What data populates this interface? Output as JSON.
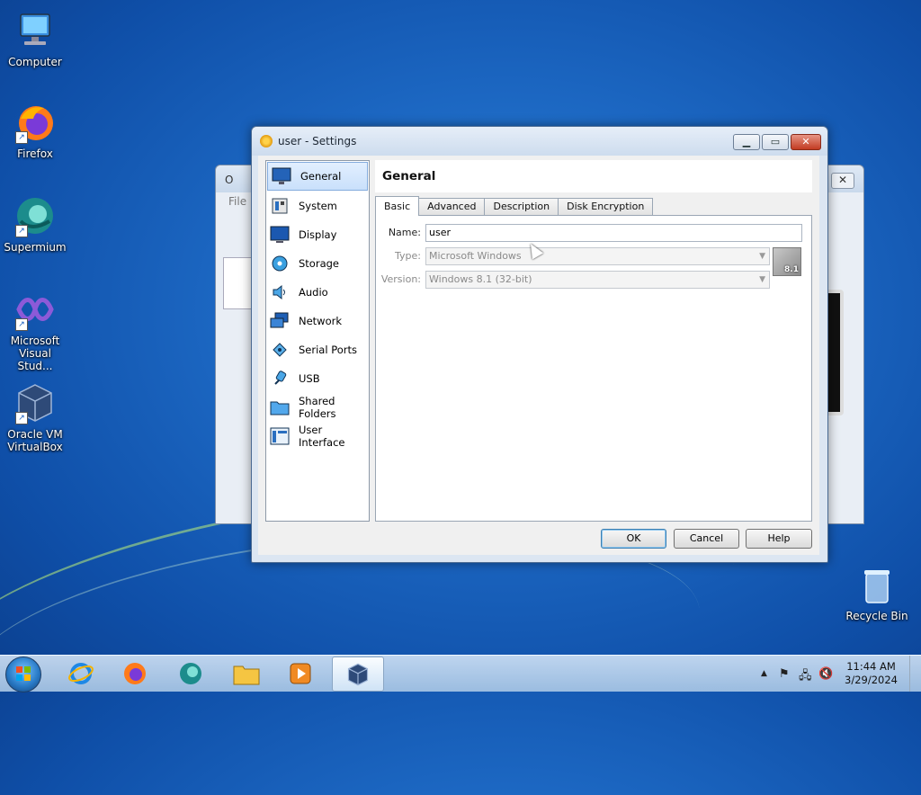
{
  "desktop": {
    "icons": [
      {
        "label": "Computer"
      },
      {
        "label": "Firefox"
      },
      {
        "label": "Supermium"
      },
      {
        "label": "Microsoft Visual Stud..."
      },
      {
        "label": "Oracle VM VirtualBox"
      },
      {
        "label": "Recycle Bin"
      }
    ]
  },
  "background_window": {
    "title_fragment": "O",
    "menu_file": "File"
  },
  "dialog": {
    "title": "user - Settings",
    "min_symbol": "▁",
    "max_symbol": "▭",
    "close_symbol": "✕"
  },
  "nav": {
    "items": [
      {
        "label": "General",
        "icon": "monitor-icon",
        "selected": true
      },
      {
        "label": "System",
        "icon": "chip-icon"
      },
      {
        "label": "Display",
        "icon": "display-icon"
      },
      {
        "label": "Storage",
        "icon": "disk-icon"
      },
      {
        "label": "Audio",
        "icon": "speaker-icon"
      },
      {
        "label": "Network",
        "icon": "network-icon"
      },
      {
        "label": "Serial Ports",
        "icon": "serial-port-icon"
      },
      {
        "label": "USB",
        "icon": "usb-icon"
      },
      {
        "label": "Shared Folders",
        "icon": "folder-icon"
      },
      {
        "label": "User Interface",
        "icon": "ui-icon"
      }
    ]
  },
  "section": {
    "title": "General",
    "tabs": [
      {
        "label": "Basic",
        "active": true
      },
      {
        "label": "Advanced"
      },
      {
        "label": "Description"
      },
      {
        "label": "Disk Encryption"
      }
    ]
  },
  "form": {
    "name_label": "Name:",
    "name_value": "user",
    "type_label": "Type:",
    "type_value": "Microsoft Windows",
    "version_label": "Version:",
    "version_value": "Windows 8.1 (32-bit)",
    "os_badge_text": "8.1"
  },
  "buttons": {
    "ok": "OK",
    "cancel": "Cancel",
    "help": "Help"
  },
  "taskbar": {
    "apps": [
      "Internet Explorer",
      "Firefox",
      "Supermium",
      "File Explorer",
      "Media Player",
      "VirtualBox"
    ],
    "clock_time": "11:44 AM",
    "clock_date": "3/29/2024",
    "tray_arrow": "▲"
  },
  "colors": {
    "accent": "#3c7fb1",
    "selection": "#c9e0fb",
    "close_red": "#c23b22"
  }
}
